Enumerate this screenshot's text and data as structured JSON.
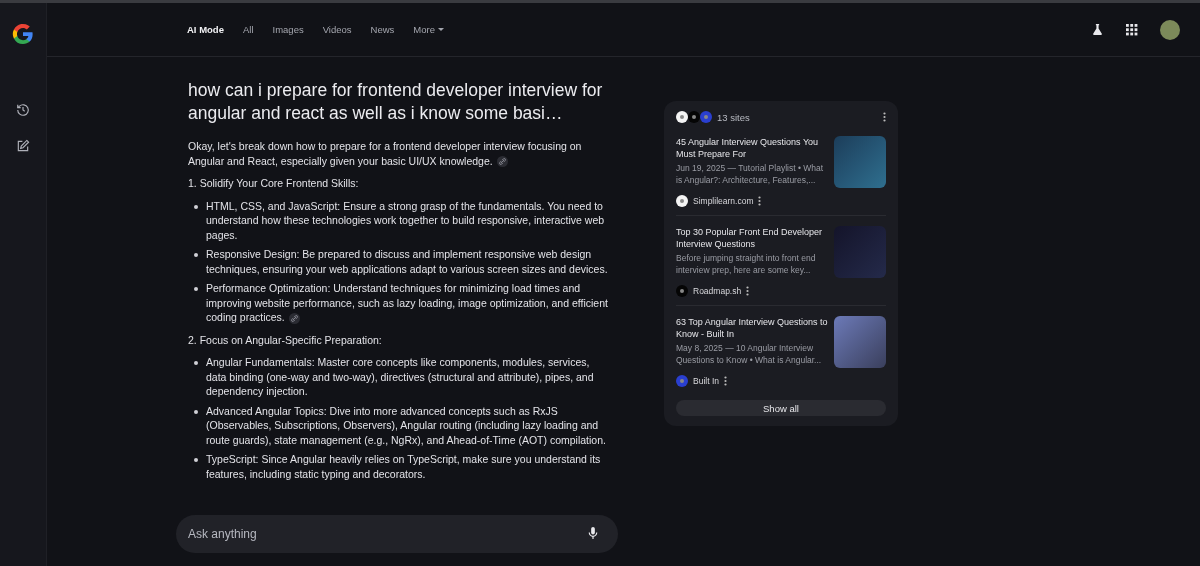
{
  "nav": {
    "tabs": [
      {
        "label": "AI Mode",
        "selected": true,
        "kind": "tab"
      },
      {
        "label": "All",
        "selected": false,
        "kind": "tab"
      },
      {
        "label": "Images",
        "selected": false,
        "kind": "tab"
      },
      {
        "label": "Videos",
        "selected": false,
        "kind": "tab"
      },
      {
        "label": "News",
        "selected": false,
        "kind": "tab"
      },
      {
        "label": "More",
        "selected": false,
        "kind": "menu"
      }
    ]
  },
  "query": "how can i prepare for frontend developer interview for angular and react as well as i know some basi…",
  "answer": [
    {
      "kind": "paragraph",
      "text": "Okay, let's break down how to prepare for a frontend developer interview focusing on Angular and React, especially given your basic UI/UX knowledge.",
      "cited": true
    },
    {
      "kind": "heading",
      "text": "1. Solidify Your Core Frontend Skills:"
    },
    {
      "kind": "bullets",
      "items": [
        {
          "text": "HTML, CSS, and JavaScript: Ensure a strong grasp of the fundamentals. You need to understand how these technologies work together to build responsive, interactive web pages.",
          "cited": false
        },
        {
          "text": "Responsive Design: Be prepared to discuss and implement responsive web design techniques, ensuring your web applications adapt to various screen sizes and devices.",
          "cited": false
        },
        {
          "text": "Performance Optimization: Understand techniques for minimizing load times and improving website performance, such as lazy loading, image optimization, and efficient coding practices.",
          "cited": true
        }
      ]
    },
    {
      "kind": "heading",
      "text": "2. Focus on Angular-Specific Preparation:"
    },
    {
      "kind": "bullets",
      "items": [
        {
          "text": "Angular Fundamentals: Master core concepts like components, modules, services, data binding (one-way and two-way), directives (structural and attribute), pipes, and dependency injection.",
          "cited": false
        },
        {
          "text": "Advanced Angular Topics: Dive into more advanced concepts such as RxJS (Observables, Subscriptions, Observers), Angular routing (including lazy loading and route guards), state management (e.g., NgRx), and Ahead-of-Time (AOT) compilation.",
          "cited": false
        },
        {
          "text": "TypeScript: Since Angular heavily relies on TypeScript, make sure you understand its features, including static typing and decorators.",
          "cited": false
        }
      ]
    }
  ],
  "sources": {
    "count": "13 sites",
    "items": [
      {
        "title": "45 Angular Interview Questions You Must Prepare For",
        "snippet": "Jun 19, 2025 — Tutorial Playlist • What is Angular?: Architecture, Features,...",
        "site": "Simplilearn.com",
        "color": "#f4f4f4"
      },
      {
        "title": "Top 30 Popular Front End Developer Interview Questions",
        "snippet": "Before jumping straight into front end interview prep, here are some key...",
        "site": "Roadmap.sh",
        "color": "#050505"
      },
      {
        "title": "63 Top Angular Interview Questions to Know - Built In",
        "snippet": "May 8, 2025 — 10 Angular Interview Questions to Know • What is Angular...",
        "site": "Built In",
        "color": "#2a3fd0"
      }
    ],
    "button": "Show all"
  },
  "prompt": {
    "placeholder": "Ask anything"
  }
}
